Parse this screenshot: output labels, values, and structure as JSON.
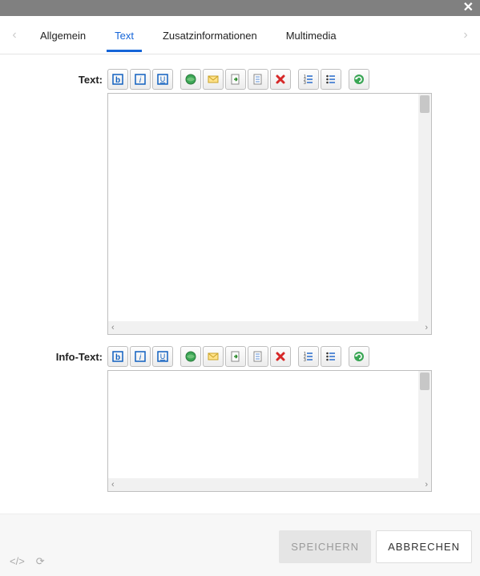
{
  "titlebar": {
    "close_glyph": "✕"
  },
  "tabs": {
    "arrow_left": "‹",
    "arrow_right": "›",
    "items": [
      {
        "label": "Allgemein",
        "active": false
      },
      {
        "label": "Text",
        "active": true
      },
      {
        "label": "Zusatzinformationen",
        "active": false
      },
      {
        "label": "Multimedia",
        "active": false
      }
    ]
  },
  "fields": [
    {
      "label": "Text:",
      "editor_size": "big"
    },
    {
      "label": "Info-Text:",
      "editor_size": "small"
    }
  ],
  "toolbar_buttons": [
    {
      "name": "bold-icon",
      "group": 0
    },
    {
      "name": "italic-icon",
      "group": 0
    },
    {
      "name": "underline-icon",
      "group": 0
    },
    {
      "name": "link-icon",
      "group": 1
    },
    {
      "name": "mail-icon",
      "group": 1
    },
    {
      "name": "insert-icon",
      "group": 1
    },
    {
      "name": "note-icon",
      "group": 1
    },
    {
      "name": "remove-icon",
      "group": 1
    },
    {
      "name": "ordered-list-icon",
      "group": 2
    },
    {
      "name": "unordered-list-icon",
      "group": 2
    },
    {
      "name": "refresh-icon",
      "group": 3
    }
  ],
  "scroll": {
    "left_glyph": "‹",
    "right_glyph": "›"
  },
  "footer": {
    "save_label": "SPEICHERN",
    "cancel_label": "ABBRECHEN",
    "code_glyph": "</>",
    "refresh_glyph": "⟳"
  }
}
